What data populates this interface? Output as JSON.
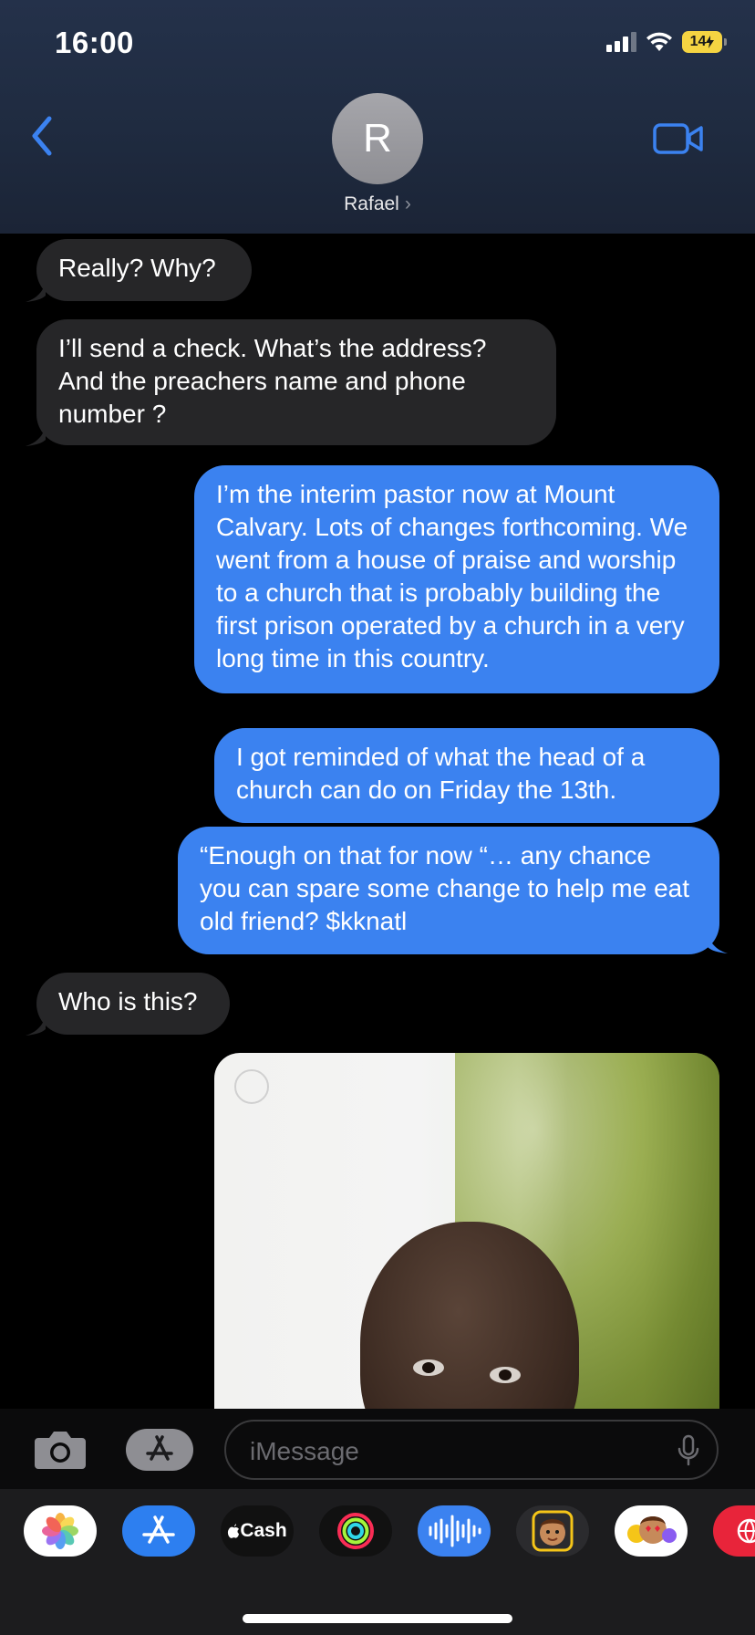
{
  "status_bar": {
    "time": "16:00",
    "battery": "14"
  },
  "header": {
    "contact_initial": "R",
    "contact_name": "Rafael",
    "chevron": "›"
  },
  "messages": [
    {
      "direction": "in",
      "text": "Really?  Why?"
    },
    {
      "direction": "in",
      "text": "I’ll send a check. What’s the address? And the preachers name and phone number ?"
    },
    {
      "direction": "out",
      "text": "I’m the interim pastor now at Mount Calvary. Lots of changes forthcoming. We went from a house of praise and worship to a church that is probably building the first prison operated by a church in a very long time in this country."
    },
    {
      "direction": "out",
      "text": "I got reminded of what the head of a church can do on Friday the 13th."
    },
    {
      "direction": "out",
      "text": "“Enough on that for now “… any chance you can spare some change to help me eat old friend? $kknatl"
    },
    {
      "direction": "in",
      "text": "Who is this?"
    }
  ],
  "compose": {
    "placeholder": "iMessage"
  },
  "app_drawer": {
    "apps": [
      {
        "icon": "photos-icon"
      },
      {
        "icon": "app-store-icon"
      },
      {
        "icon": "apple-cash-icon",
        "label": "Cash"
      },
      {
        "icon": "activity-icon"
      },
      {
        "icon": "audio-message-icon"
      },
      {
        "icon": "memoji-icon"
      },
      {
        "icon": "memoji-stickers-icon"
      },
      {
        "icon": "globe-icon"
      }
    ]
  },
  "colors": {
    "accent": "#3b82f0",
    "incoming": "#262628",
    "battery": "#f5d442"
  }
}
